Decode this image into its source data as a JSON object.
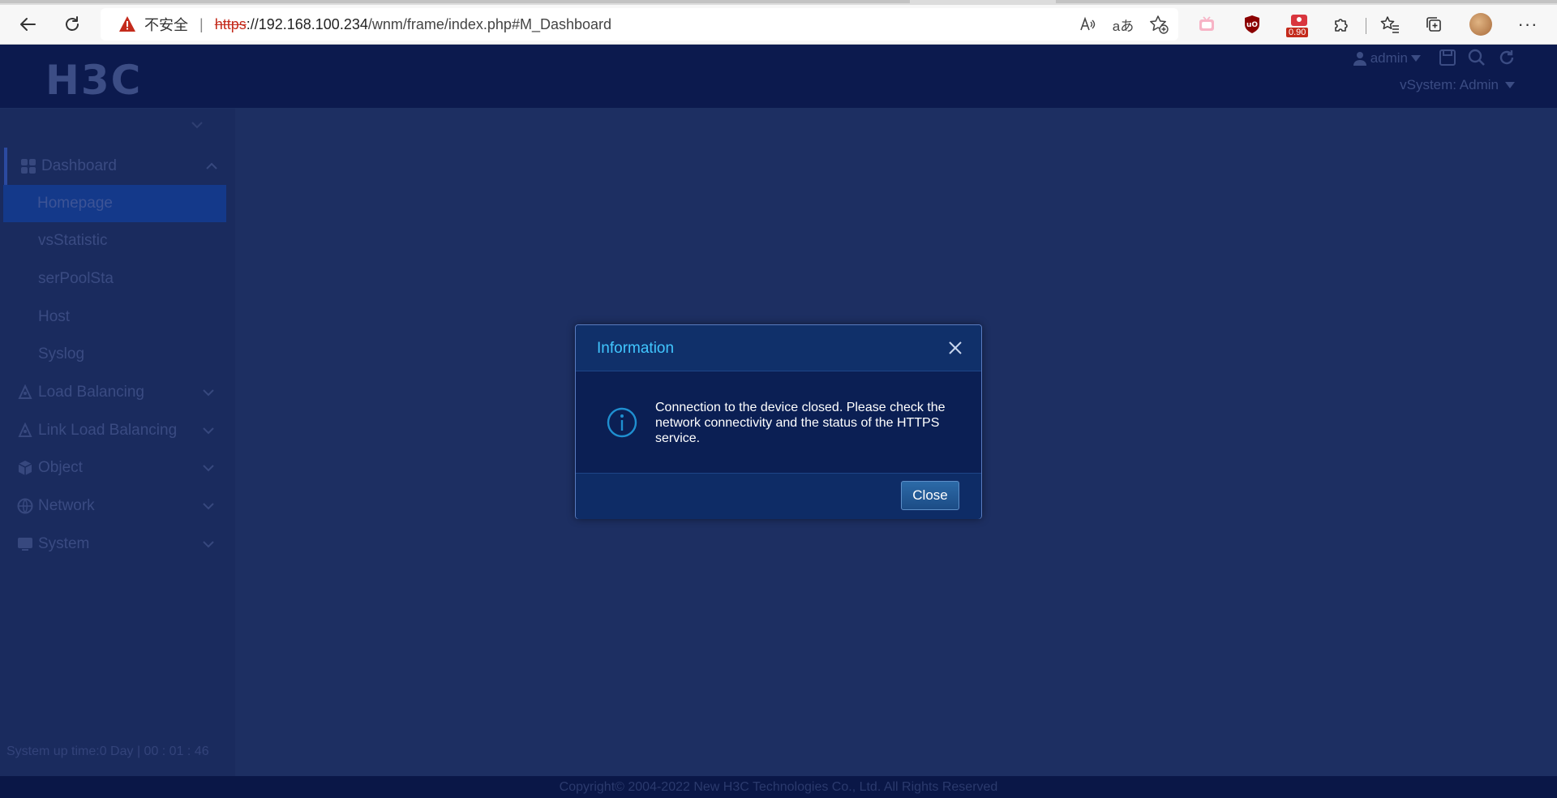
{
  "browser": {
    "security_label": "不安全",
    "url_scheme": "https",
    "url_host": "://192.168.100.234",
    "url_path": "/wnm/frame/index.php#M_Dashboard",
    "extension_badge": "0.90"
  },
  "header": {
    "logo_text": "H3C",
    "user_label": "admin",
    "vsystem_label": "vSystem: Admin"
  },
  "sidebar": {
    "items": [
      {
        "label": "Dashboard"
      },
      {
        "label": "Homepage"
      },
      {
        "label": "vsStatistic"
      },
      {
        "label": "serPoolSta"
      },
      {
        "label": "Host"
      },
      {
        "label": "Syslog"
      },
      {
        "label": "Load Balancing"
      },
      {
        "label": "Link Load Balancing"
      },
      {
        "label": "Object"
      },
      {
        "label": "Network"
      },
      {
        "label": "System"
      }
    ],
    "uptime": "System up time:0 Day | 00 : 01 : 46"
  },
  "footer": {
    "copyright": "Copyright© 2004-2022 New H3C Technologies Co., Ltd. All Rights Reserved"
  },
  "dialog": {
    "title": "Information",
    "message": "Connection to the device closed. Please check the network connectivity and the status of the HTTPS service.",
    "close_label": "Close"
  },
  "colors": {
    "dialog_title": "#41c6ff",
    "app_background": "#1d2f62",
    "header_background": "#0c1a4e"
  }
}
